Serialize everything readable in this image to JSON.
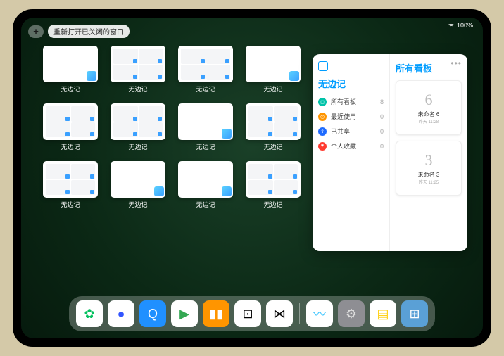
{
  "statusbar": {
    "wifi": "ᯤ",
    "battery": "100%"
  },
  "topbar": {
    "plus": "+",
    "reopen_label": "重新打开已关闭的窗口"
  },
  "thumbs": [
    {
      "label": "无边记",
      "type": "blank"
    },
    {
      "label": "无边记",
      "type": "grid"
    },
    {
      "label": "无边记",
      "type": "grid"
    },
    {
      "label": "无边记",
      "type": "blank"
    },
    {
      "label": "无边记",
      "type": "grid"
    },
    {
      "label": "无边记",
      "type": "grid"
    },
    {
      "label": "无边记",
      "type": "blank"
    },
    {
      "label": "无边记",
      "type": "grid"
    },
    {
      "label": "无边记",
      "type": "grid"
    },
    {
      "label": "无边记",
      "type": "blank"
    },
    {
      "label": "无边记",
      "type": "blank"
    },
    {
      "label": "无边记",
      "type": "grid"
    }
  ],
  "panel": {
    "left_title": "无边记",
    "right_title": "所有看板",
    "items": [
      {
        "icon_color": "#00c2a8",
        "glyph": "◻",
        "label": "所有看板",
        "count": "8"
      },
      {
        "icon_color": "#ff9500",
        "glyph": "◷",
        "label": "最近使用",
        "count": "0"
      },
      {
        "icon_color": "#1e6bff",
        "glyph": "⇪",
        "label": "已共享",
        "count": "0"
      },
      {
        "icon_color": "#ff3b30",
        "glyph": "♥",
        "label": "个人收藏",
        "count": "0"
      }
    ],
    "boards": [
      {
        "sketch": "6",
        "label": "未命名 6",
        "sub": "昨天 11:28"
      },
      {
        "sketch": "3",
        "label": "未命名 3",
        "sub": "昨天 11:25"
      }
    ]
  },
  "dock": [
    {
      "name": "wechat",
      "bg": "#fff",
      "fg": "#07c160",
      "glyph": "✿"
    },
    {
      "name": "quark",
      "bg": "#fff",
      "fg": "#3355ff",
      "glyph": "●"
    },
    {
      "name": "qqbrowser",
      "bg": "#2090ff",
      "fg": "#fff",
      "glyph": "Q"
    },
    {
      "name": "play",
      "bg": "#fff",
      "fg": "#34a853",
      "glyph": "▶"
    },
    {
      "name": "books",
      "bg": "#ff9500",
      "fg": "#fff",
      "glyph": "▮▮"
    },
    {
      "name": "dice",
      "bg": "#fff",
      "fg": "#000",
      "glyph": "⊡"
    },
    {
      "name": "graph",
      "bg": "#fff",
      "fg": "#000",
      "glyph": "⋈"
    },
    {
      "name": "freeform",
      "bg": "#fff",
      "fg": "#34c2ff",
      "glyph": "〰"
    },
    {
      "name": "settings",
      "bg": "#8e8e93",
      "fg": "#ddd",
      "glyph": "⚙"
    },
    {
      "name": "notes",
      "bg": "#fff",
      "fg": "#ffcc00",
      "glyph": "▤"
    },
    {
      "name": "appfolder",
      "bg": "#5aa0d6",
      "fg": "#fff",
      "glyph": "⊞"
    }
  ]
}
